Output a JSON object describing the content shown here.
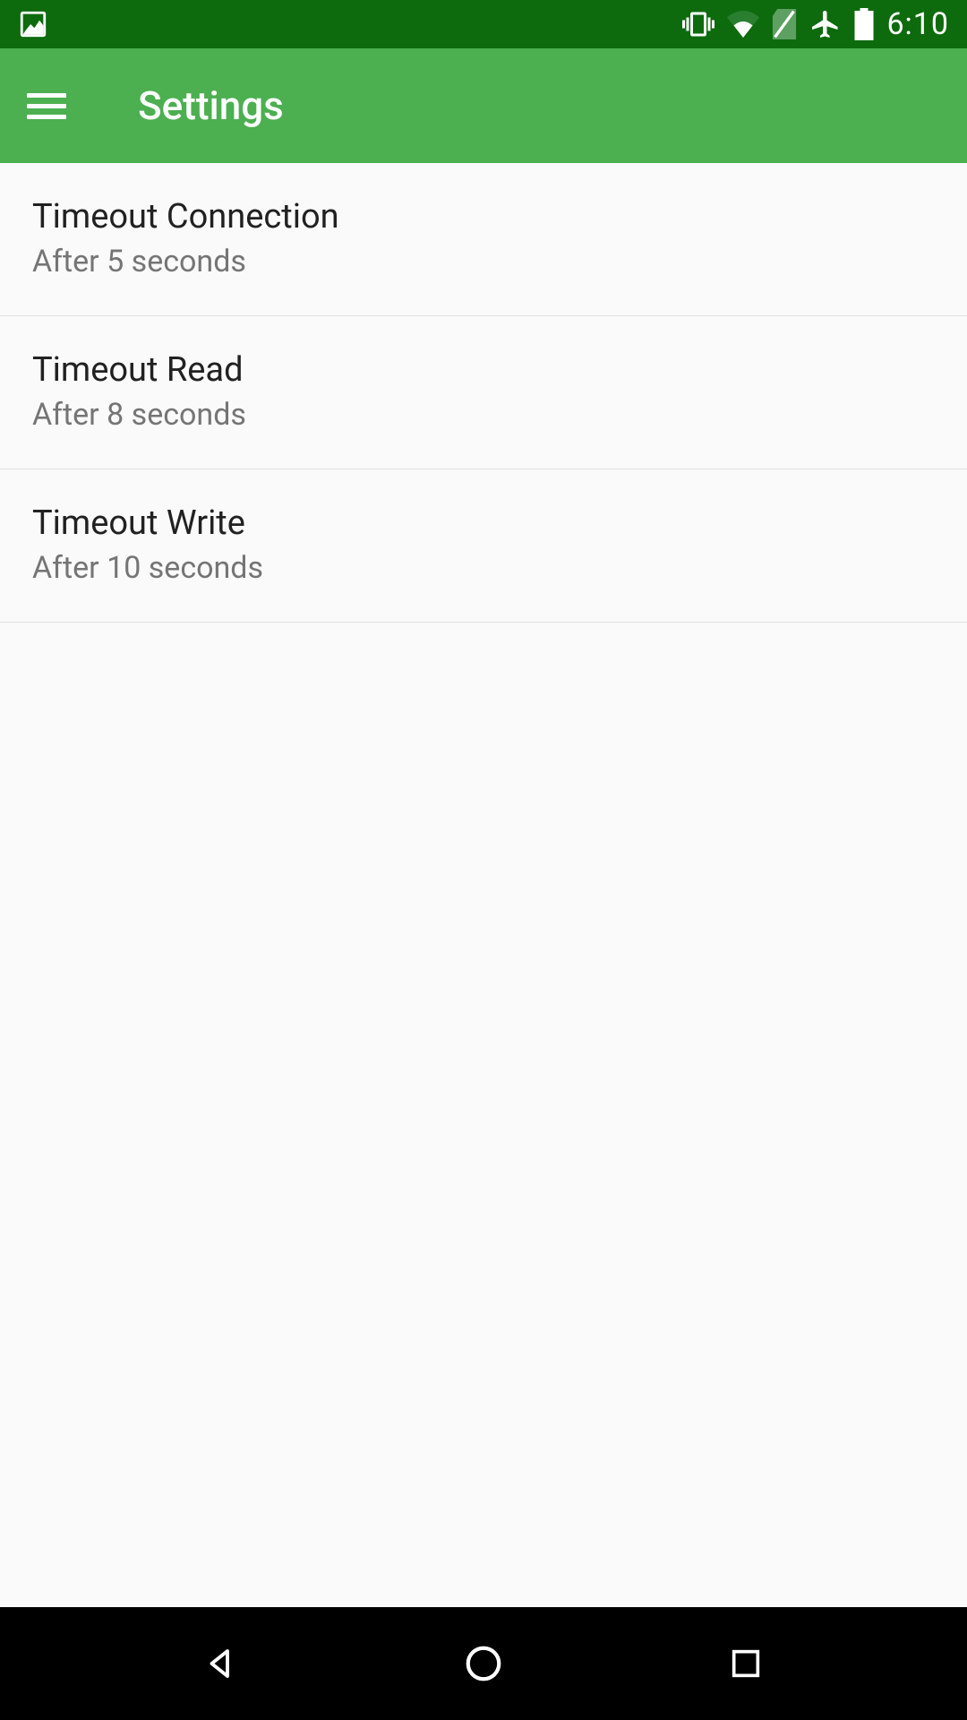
{
  "statusBar": {
    "time": "6:10"
  },
  "appBar": {
    "title": "Settings"
  },
  "settings": {
    "items": [
      {
        "title": "Timeout Connection",
        "subtitle": "After 5 seconds"
      },
      {
        "title": "Timeout Read",
        "subtitle": "After 8 seconds"
      },
      {
        "title": "Timeout Write",
        "subtitle": "After 10 seconds"
      }
    ]
  }
}
